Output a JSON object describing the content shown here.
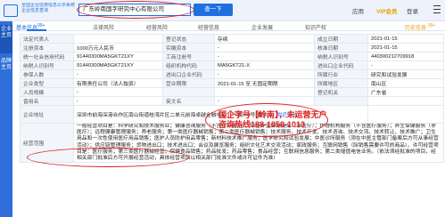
{
  "header": {
    "banner_text": "全国企业信用信息公示系统企业信息查询",
    "search_value": "广东岭南国字研究中心有限公司",
    "search_button": "查一下",
    "nav": [
      "应用",
      "VIP会员",
      "登录"
    ],
    "accent": "#1f6fe0"
  },
  "sidebar": {
    "tabs": [
      "企业主页",
      "品牌主页"
    ]
  },
  "tabs": {
    "items": [
      "基本信息",
      "法律风险",
      "经营风险",
      "经营信息",
      "企业发展",
      "知识产权",
      "历史信息"
    ],
    "counts": [
      "99+",
      "",
      "",
      "",
      "",
      "",
      "99+"
    ],
    "right_items": [
      "历史信息",
      "99+"
    ]
  },
  "table": {
    "rows": [
      {
        "l1": "法定代表人",
        "v1": "",
        "l2": "登记状态",
        "v2": "存续",
        "l3": "成立日期",
        "v3": "2021-01-15"
      },
      {
        "l1": "注册资本",
        "v1": "1000万元人民币",
        "l2": "实缴资本",
        "v2": "-",
        "l3": "核准日期",
        "v3": "2021-01-15"
      },
      {
        "l1": "统一社会信用代码",
        "v1": "91440300MA5GKT21XY",
        "l2": "工商注册号",
        "v2": "-",
        "l3": "纳税人识别号",
        "v3": "440300212709918"
      },
      {
        "l1": "纳税人识别号",
        "v1": "91440300MA5GKT21XY",
        "l2": "组织机构代码",
        "v2": "MA5GKT21-X",
        "l3": "进出口企业代码",
        "v3": "-"
      },
      {
        "l1": "参保人数",
        "v1": "-",
        "l2": "进出口企业代码",
        "v2": "-",
        "l3": "所属行业",
        "v3": "研究和试验发展"
      },
      {
        "l1": "企业类型",
        "v1": "有限责任公司（法人独资）",
        "l2": "营业期限",
        "v2": "2021-01-15 至 无固定期限",
        "l3": "所属地区",
        "v3": "南山区"
      },
      {
        "l1": "人员规模",
        "v1": "-",
        "l2": "",
        "v2": "",
        "l3": "登记机关",
        "v3": "广东省"
      },
      {
        "l1": "曾用名",
        "v1": "-",
        "l2": "英文名",
        "v2": "-",
        "l3": "",
        "v3": ""
      }
    ],
    "address_label": "企业地址",
    "address_value": "深圳市前海深港合作区南山街道桂湾片区二单元前海卓越金融中心（一期）8号楼2011",
    "address_extra": "附近企业",
    "scope_label": "经营范围",
    "scope_value": "一般经营项目是：科学研究和技术服务业；健康咨询服务（不含诊疗服务）；中医养生保健服务（非医疗）；护理机构服务（不含医疗服务）；养生保健服务（非医疗）；远程健康管理服务；养老服务；第一类医疗器械销售；第二类医疗器械销售；技术服务、技术开发、技术咨询、技术交流、技术转让、技术推广；卫生用品和一次性使用医疗用品销售；医护人员防护用品零售；新材料技术推广服务；医学研究和试验发展；中医诊所服务（须在中医主管部门备案后方可从事经营活动）；供应链管理服务；货物进出口；技术进出口；会议及展览服务；组织文化艺术交流活动；家政服务；互联网销售（除销售需要许可的商品）。许可经营项目是：医疗服务；第三类医疗器械经营；保健食品销售；药品批发；药品零售；食品经营；互联网信息服务；第二类增值电信业务。（依法须经批准的项目，经相关部门批准后方可开展经营活动，具体经营项目以相关部门批准文件或许可证件为准）"
  },
  "promo": {
    "line1": "国企字号【岭南】，未运营无户",
    "line2": "咨询热线188-1858-1013",
    "color": "#e02020"
  }
}
